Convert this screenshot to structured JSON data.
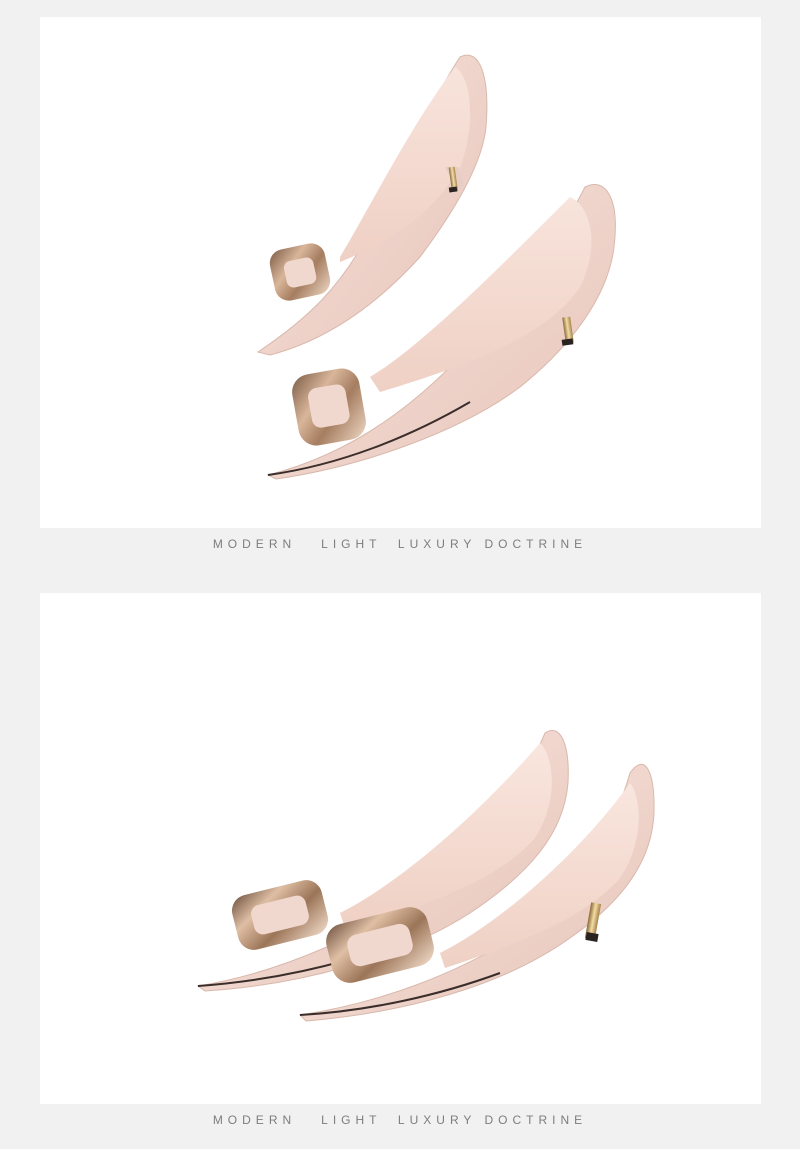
{
  "taglines": {
    "top": "MODERN   LIGHT  LUXURY DOCTRINE",
    "bottom": "MODERN   LIGHT  LUXURY DOCTRINE"
  },
  "colors": {
    "page_background": "#f1f1f1",
    "panel_background": "#ffffff",
    "shoe_leather": "#f2d9d2",
    "shoe_lining": "#f7e2da",
    "buckle_gold": "#b08a6a",
    "tagline_text": "#7d7d7d"
  },
  "images": [
    {
      "name": "pair-of-pink-pumps-angled",
      "subject": "pair of nude pink patent pointed-toe kitten heel pumps with square gold buckles"
    },
    {
      "name": "pair-of-pink-pumps-side-by-side",
      "subject": "pair of nude pink patent pointed-toe kitten heel pumps with square gold buckles"
    }
  ]
}
